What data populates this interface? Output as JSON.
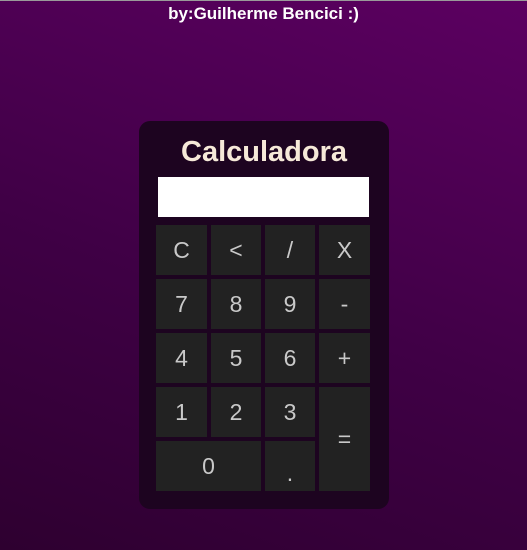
{
  "page": {
    "credit": "by:Guilherme Bencici :)"
  },
  "calculator": {
    "title": "Calculadora",
    "display_value": "",
    "keys": {
      "clear": "C",
      "backspace": "<",
      "divide": "/",
      "multiply": "X",
      "seven": "7",
      "eight": "8",
      "nine": "9",
      "minus": "-",
      "four": "4",
      "five": "5",
      "six": "6",
      "plus": "+",
      "one": "1",
      "two": "2",
      "three": "3",
      "equals": "=",
      "zero": "0",
      "decimal": "."
    }
  },
  "colors": {
    "background_start": "#2e0030",
    "background_end": "#5c0061",
    "panel": "#1d0420",
    "key_background": "#222222",
    "key_text": "#c9c9c9",
    "title_text": "#f6e9d8"
  }
}
